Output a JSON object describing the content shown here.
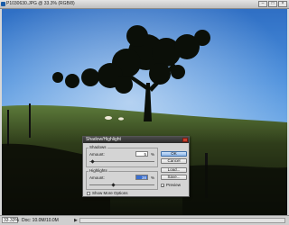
{
  "window": {
    "title": "P1030630.JPG @ 33.3% (RGB/8)",
    "colors": {
      "titlebar": "#cfcfcf",
      "sky": "#4b8fdc",
      "dialog_title": "#2c2c2c",
      "selection": "#3a6fd0"
    }
  },
  "statusbar": {
    "zoom": "33.33%",
    "doc": "Doc: 10.0M/10.0M"
  },
  "dialog": {
    "title": "Shadow/Highlight",
    "shadows": {
      "label": "Shadows",
      "amount_label": "Amount:",
      "value": "5",
      "unit": "%"
    },
    "highlights": {
      "label": "Highlights",
      "amount_label": "Amount:",
      "value": "38",
      "unit": "%"
    },
    "buttons": {
      "ok": "OK",
      "cancel": "Cancel",
      "load": "Load...",
      "save": "Save..."
    },
    "preview": {
      "label": "Preview",
      "checked": true
    },
    "more_options": {
      "label": "Show More Options",
      "checked": false
    }
  }
}
